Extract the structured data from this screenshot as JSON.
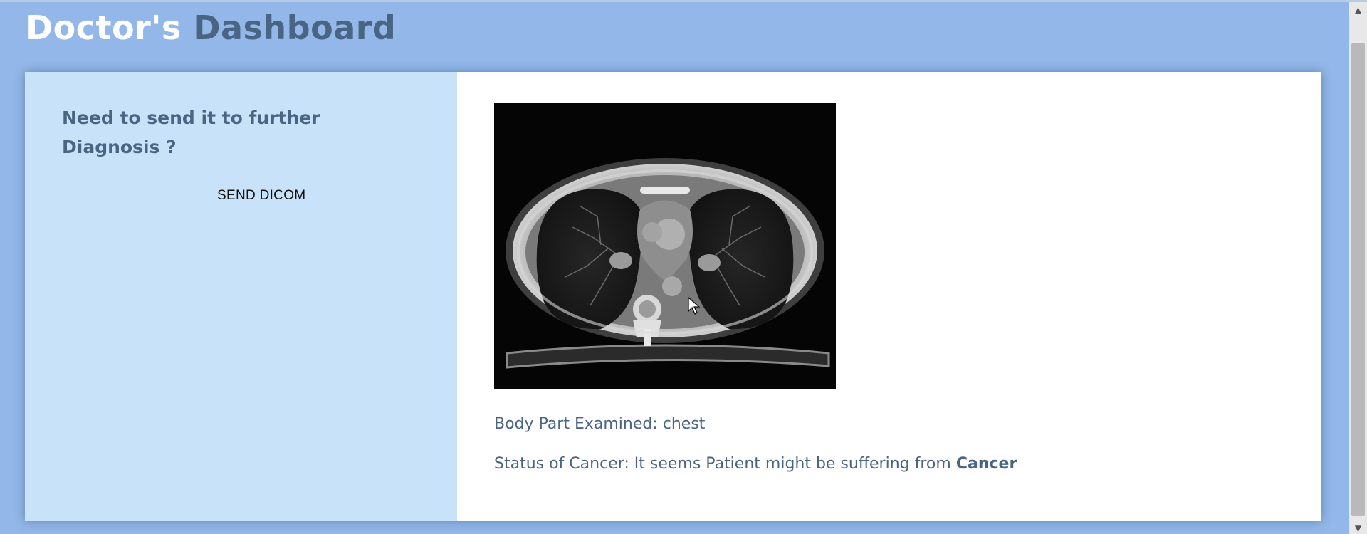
{
  "header": {
    "title_part1": "Doctor's",
    "title_part2": "Dashboard"
  },
  "left_panel": {
    "heading": "Need to send it to further Diagnosis ?",
    "send_button_label": "SEND DICOM"
  },
  "right_panel": {
    "image_alt": "CT scan of chest",
    "body_part_line": "Body Part Examined: chest",
    "status_prefix": "Status of Cancer: It seems Patient might be suffering from",
    "status_result": "Cancer"
  },
  "colors": {
    "background": "#93b7e8",
    "left_panel": "#c8e2fa",
    "title_accent": "#4a6484",
    "text": "#4a6484"
  },
  "icons": {
    "scroll_up": "scroll-up-arrow-icon",
    "scroll_down": "scroll-down-arrow-icon",
    "cursor": "mouse-pointer-icon"
  }
}
